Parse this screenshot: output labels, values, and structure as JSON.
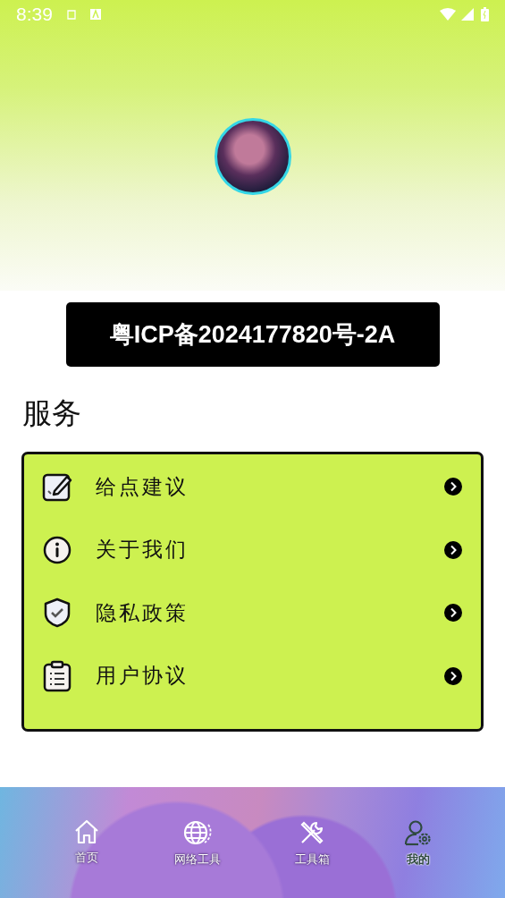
{
  "status_bar": {
    "time": "8:39"
  },
  "icp_banner": "粤ICP备2024177820号-2A",
  "section_title": "服务",
  "services": [
    {
      "kind": "feedback",
      "label": "给点建议"
    },
    {
      "kind": "about",
      "label": "关于我们"
    },
    {
      "kind": "privacy",
      "label": "隐私政策"
    },
    {
      "kind": "agreement",
      "label": "用户协议"
    }
  ],
  "nav": [
    {
      "kind": "home",
      "label": "首页",
      "selected": false
    },
    {
      "kind": "network",
      "label": "网络工具",
      "selected": false
    },
    {
      "kind": "tools",
      "label": "工具箱",
      "selected": false
    },
    {
      "kind": "profile",
      "label": "我的",
      "selected": true
    }
  ]
}
